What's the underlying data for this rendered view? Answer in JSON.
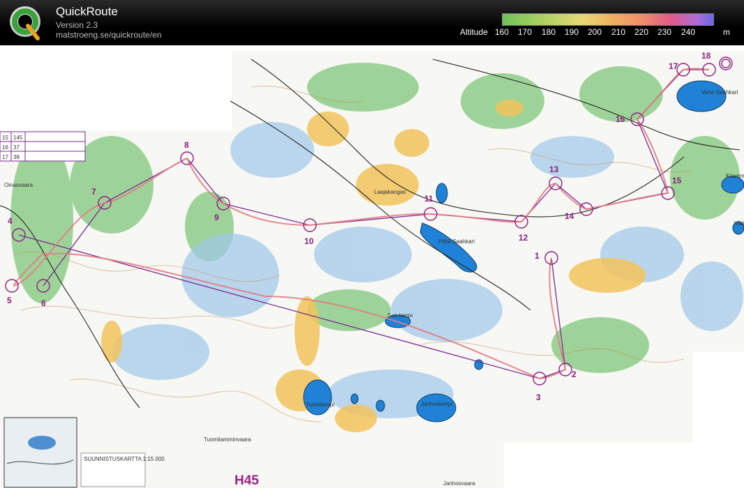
{
  "app": {
    "name": "QuickRoute",
    "version": "Version 2.3",
    "url": "matstroeng.se/quickroute/en"
  },
  "legend": {
    "label": "Altitude",
    "ticks": [
      "160",
      "170",
      "180",
      "190",
      "200",
      "210",
      "220",
      "230",
      "240"
    ],
    "unit": "m"
  },
  "map": {
    "course_name": "H45",
    "place_names": [
      "Oinasvaara",
      "Laajakangas",
      "Pitkä-Saahkari",
      "Vene-Saahkari",
      "Suo-lampi",
      "Tuomilampi",
      "Janhoslampi",
      "Tuomilamminvaara",
      "Janhosvaara",
      "Kiiamma Saahkari",
      "Väärä"
    ],
    "controls": [
      "1",
      "2",
      "3",
      "4",
      "5",
      "6",
      "7",
      "8",
      "9",
      "10",
      "11",
      "12",
      "13",
      "14",
      "15",
      "16",
      "17",
      "18"
    ],
    "legend_table": {
      "rows": [
        [
          "15",
          "145"
        ],
        [
          "16",
          "37"
        ],
        [
          "17",
          "38"
        ]
      ]
    },
    "info_text": "SUUNNISTUSKARTTA 1:15 000"
  }
}
